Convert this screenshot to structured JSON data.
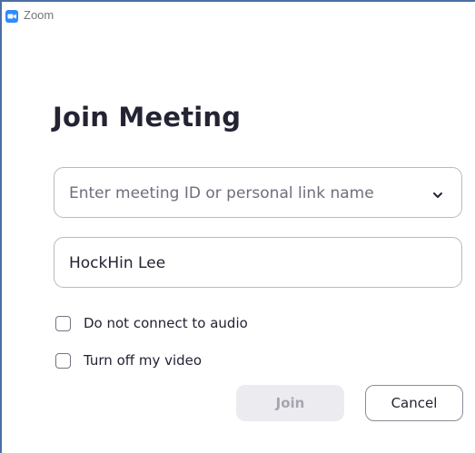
{
  "window": {
    "title": "Zoom",
    "app_icon": "zoom-camera-icon"
  },
  "main": {
    "heading": "Join Meeting",
    "meeting_id_field": {
      "placeholder": "Enter meeting ID or personal link name",
      "dropdown_icon": "chevron-down-icon"
    },
    "name_field": {
      "value": "HockHin Lee"
    },
    "options": [
      {
        "label": "Do not connect to audio",
        "checked": false
      },
      {
        "label": "Turn off my video",
        "checked": false
      }
    ],
    "buttons": {
      "join_label": "Join",
      "join_enabled": false,
      "cancel_label": "Cancel"
    }
  },
  "colors": {
    "accent": "#2d8cff",
    "window_border": "#4a6fa5",
    "text": "#232333",
    "disabled_button_bg": "#ececf0",
    "disabled_button_text": "#a5a5b0"
  }
}
